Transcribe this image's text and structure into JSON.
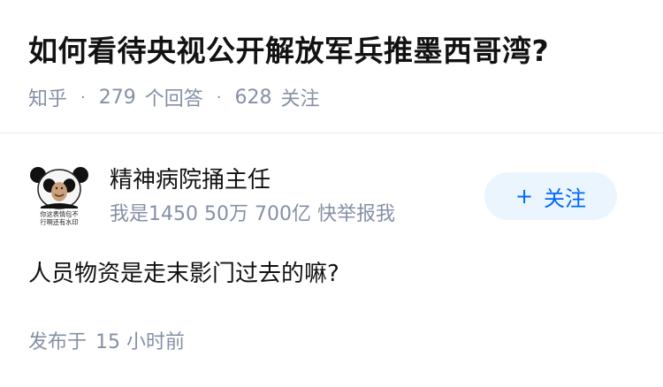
{
  "question": {
    "title": "如何看待央视公开解放军兵推墨西哥湾?",
    "source": "知乎",
    "answer_count": "279",
    "answer_label": "个回答",
    "follower_count": "628",
    "follower_label": "关注"
  },
  "answer": {
    "author": {
      "name": "精神病院捅主任",
      "bio": "我是1450 50万 700亿 快举报我",
      "avatar_icon": "panda-meme-avatar",
      "avatar_caption_line1": "你这表情包不",
      "avatar_caption_line2": "行啊还有水印"
    },
    "follow_button": {
      "icon": "+",
      "label": "关注"
    },
    "content": "人员物资是走末影门过去的嘛?",
    "publish_prefix": "发布于",
    "publish_time": "15 小时前"
  },
  "colors": {
    "title": "#121212",
    "secondary": "#8590a6",
    "accent": "#0066ff",
    "button_bg": "#ebf5fd",
    "divider": "#ebebeb"
  }
}
